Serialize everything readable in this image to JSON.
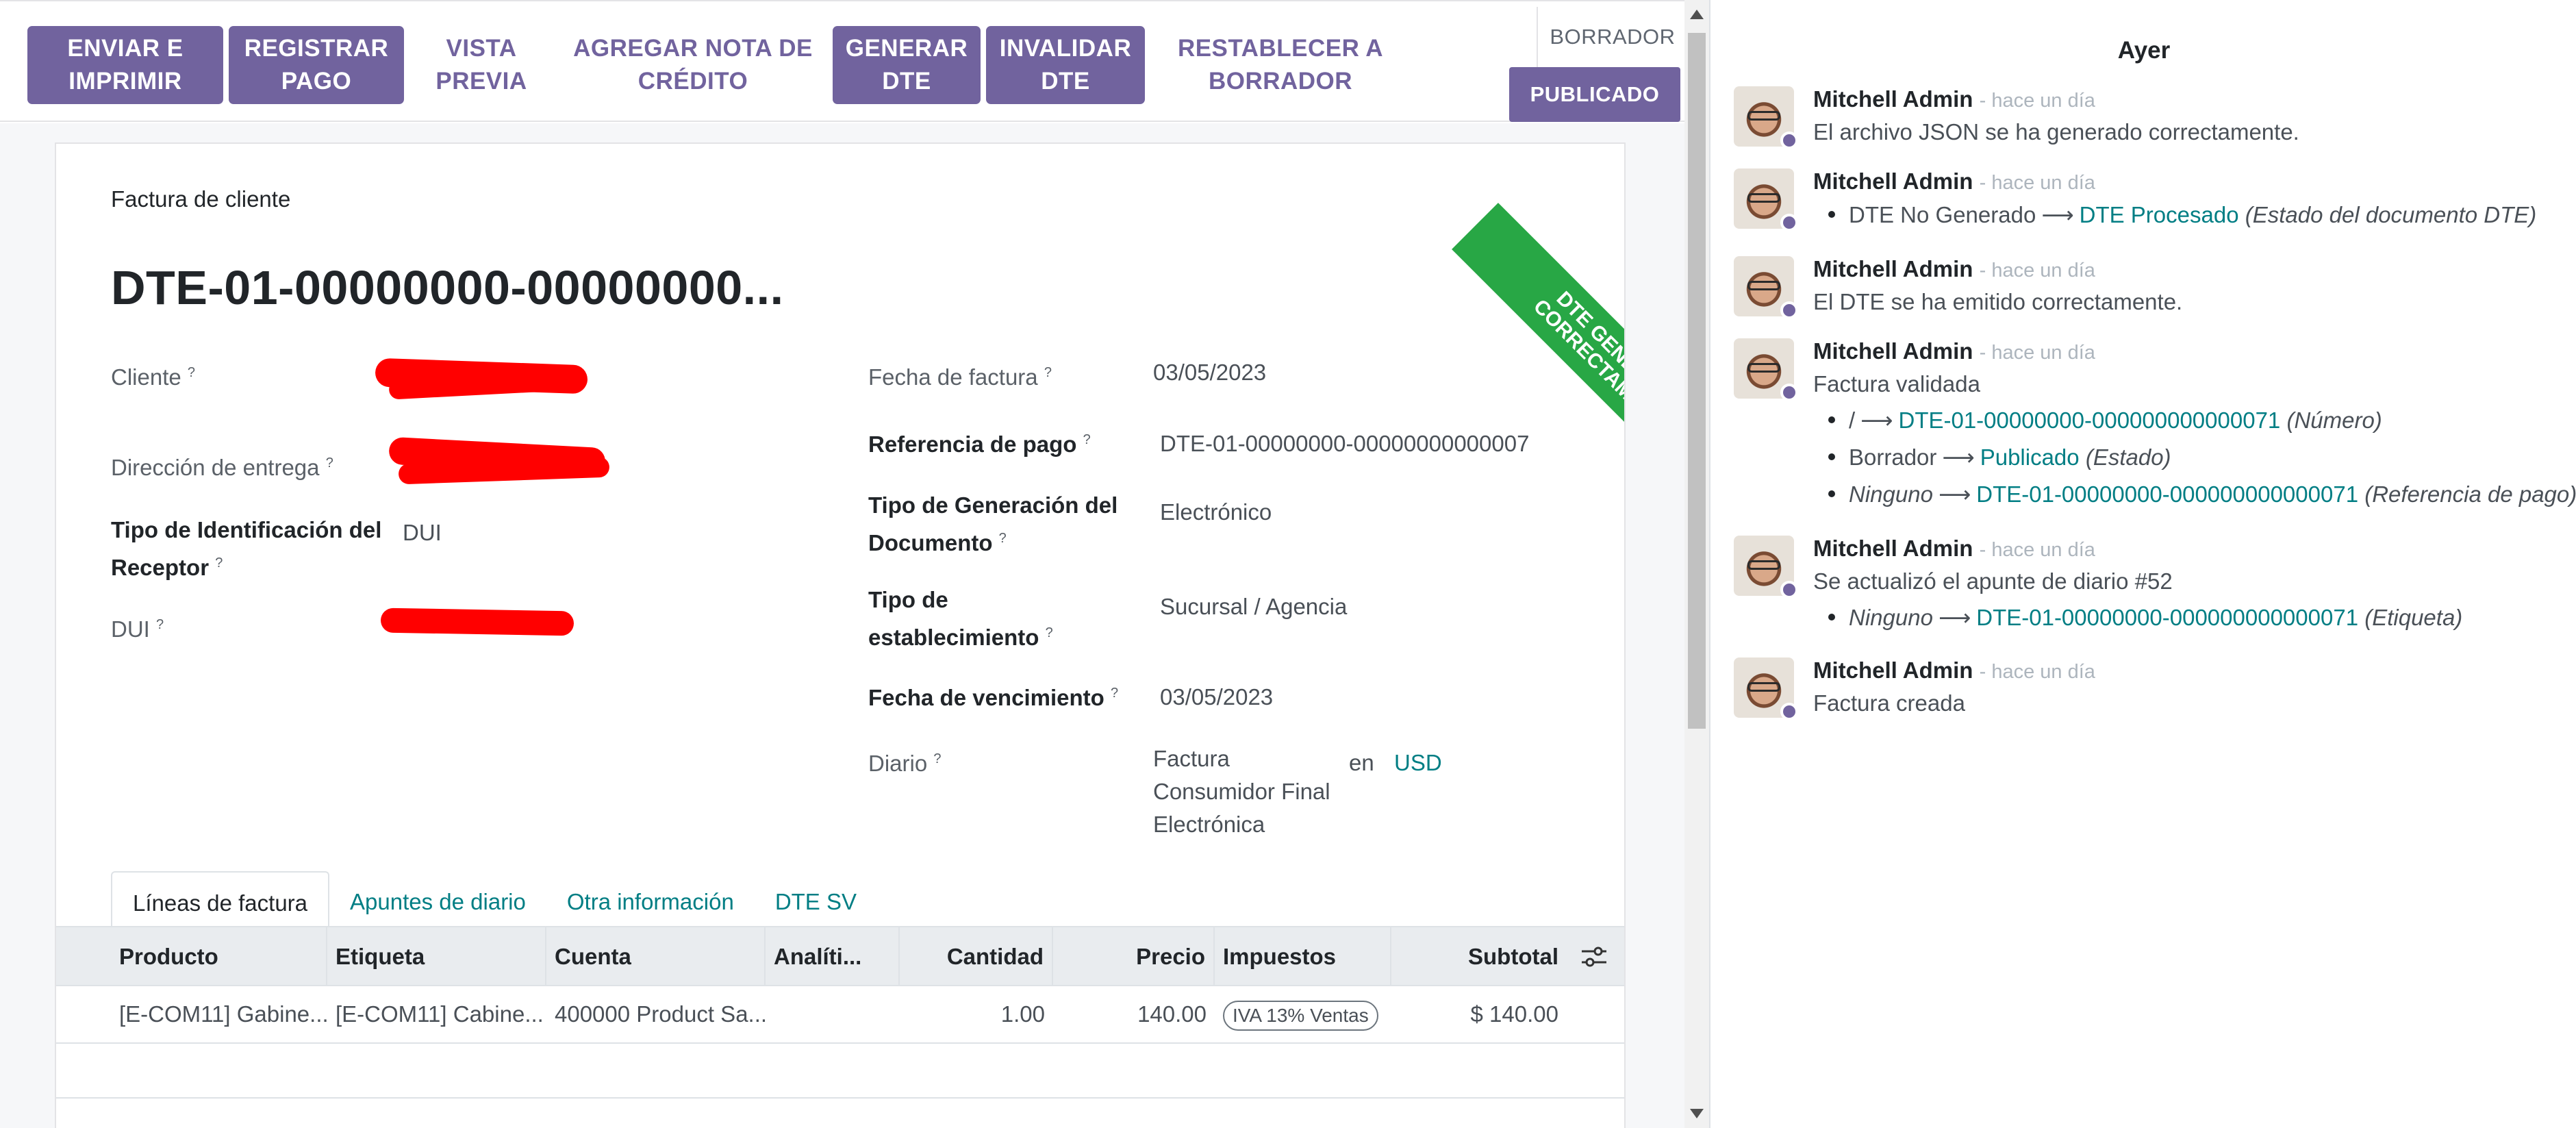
{
  "toolbar": {
    "buttons": [
      {
        "label": "ENVIAR E\nIMPRIMIR",
        "style": "primary"
      },
      {
        "label": "REGISTRAR\nPAGO",
        "style": "primary"
      },
      {
        "label": "VISTA\nPREVIA",
        "style": "secondary"
      },
      {
        "label": "AGREGAR NOTA DE\nCRÉDITO",
        "style": "secondary"
      },
      {
        "label": "GENERAR\nDTE",
        "style": "primary"
      },
      {
        "label": "INVALIDAR\nDTE",
        "style": "primary"
      },
      {
        "label": "RESTABLECER A\nBORRADOR",
        "style": "secondary"
      }
    ],
    "stages": {
      "draft": "BORRADOR",
      "posted": "PUBLICADO"
    }
  },
  "form": {
    "subtype": "Factura de cliente",
    "name": "DTE-01-00000000-00000000...",
    "ribbon": "DTE GENERADO\nCORRECTAMENTE",
    "ribbon_color": "#28a745",
    "left_fields": {
      "cliente": {
        "label": "Cliente",
        "help": "?"
      },
      "direccion": {
        "label": "Dirección de entrega",
        "help": "?"
      },
      "tipo_id": {
        "label": "Tipo de Identificación del Receptor",
        "help": "?",
        "value": "DUI"
      },
      "dui": {
        "label": "DUI",
        "help": "?"
      }
    },
    "right_fields": {
      "fecha_factura": {
        "label": "Fecha de factura",
        "help": "?",
        "value": "03/05/2023"
      },
      "referencia_pago": {
        "label": "Referencia de pago",
        "help": "?",
        "value": "DTE-01-00000000-00000000000007"
      },
      "tipo_generacion": {
        "label": "Tipo de Generación del Documento",
        "help": "?",
        "value": "Electrónico"
      },
      "tipo_establecimiento": {
        "label": "Tipo de establecimiento",
        "help": "?",
        "value": "Sucursal / Agencia"
      },
      "fecha_vencimiento": {
        "label": "Fecha de vencimiento",
        "help": "?",
        "value": "03/05/2023"
      },
      "diario": {
        "label": "Diario",
        "help": "?",
        "value": "Factura Consumidor Final Electrónica",
        "en": "en",
        "currency": "USD"
      }
    },
    "tabs": [
      "Líneas de factura",
      "Apuntes de diario",
      "Otra información",
      "DTE SV"
    ],
    "columns": [
      "Producto",
      "Etiqueta",
      "Cuenta",
      "Analíti...",
      "Cantidad",
      "Precio",
      "Impuestos",
      "Subtotal"
    ],
    "rows": [
      {
        "producto": "[E-COM11] Gabine...",
        "etiqueta": "[E-COM11] Cabine...",
        "cuenta": "400000 Product Sa...",
        "analitica": "",
        "cantidad": "1.00",
        "precio": "140.00",
        "impuestos": "IVA 13% Ventas",
        "subtotal": "$ 140.00"
      }
    ]
  },
  "chatter": {
    "date_separator": "Ayer",
    "messages": [
      {
        "author": "Mitchell Admin",
        "when": "- hace un día",
        "body": "El archivo JSON se ha generado correctamente."
      },
      {
        "author": "Mitchell Admin",
        "when": "- hace un día",
        "tracking": [
          {
            "old": "DTE No Generado",
            "new": "DTE Procesado",
            "field": "(Estado del documento DTE)"
          }
        ]
      },
      {
        "author": "Mitchell Admin",
        "when": "- hace un día",
        "body": "El DTE se ha emitido correctamente."
      },
      {
        "author": "Mitchell Admin",
        "when": "- hace un día",
        "body": "Factura validada",
        "tracking": [
          {
            "old": "/",
            "new": "DTE-01-00000000-000000000000071",
            "field": "(Número)"
          },
          {
            "old": "Borrador",
            "new": "Publicado",
            "field": "(Estado)"
          },
          {
            "old": "Ninguno",
            "new": "DTE-01-00000000-000000000000071",
            "field": "(Referencia de pago)"
          }
        ]
      },
      {
        "author": "Mitchell Admin",
        "when": "- hace un día",
        "body": "Se actualizó el apunte de diario #52",
        "tracking": [
          {
            "old": "Ninguno",
            "new": "DTE-01-00000000-000000000000071",
            "field": "(Etiqueta)"
          }
        ]
      },
      {
        "author": "Mitchell Admin",
        "when": "- hace un día",
        "body": "Factura creada"
      }
    ]
  },
  "colors": {
    "primary": "#71639e",
    "link": "#017e84",
    "redaction": "#ff0000"
  }
}
